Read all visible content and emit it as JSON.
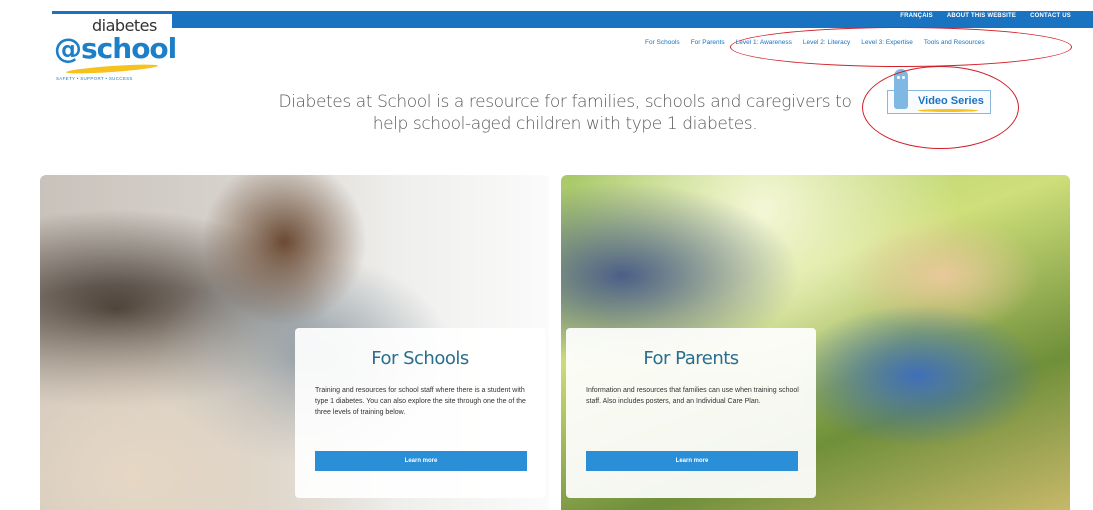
{
  "utility_nav": [
    "FRANÇAIS",
    "ABOUT THIS WEBSITE",
    "CONTACT US"
  ],
  "logo": {
    "word_top": "diabetes",
    "word_main": "@school",
    "tagline": "SAFETY • SUPPORT • SUCCESS"
  },
  "main_nav": [
    "For Schools",
    "For Parents",
    "Level 1: Awareness",
    "Level 2: Literacy",
    "Level 3: Expertise",
    "Tools and Resources"
  ],
  "hero": {
    "line1": "Diabetes at School is a resource for families, schools and caregivers to",
    "line2": "help school-aged children with type 1 diabetes."
  },
  "video_button": {
    "label": "Video Series"
  },
  "cards": {
    "schools": {
      "title": "For Schools",
      "description": "Training and resources for school staff where there is a student with type 1 diabetes. You can also explore the site through one the of the three levels of training below.",
      "button": "Learn more"
    },
    "parents": {
      "title": "For Parents",
      "description": "Information and resources that families can use when training school staff. Also includes posters, and an Individual Care Plan.",
      "button": "Learn more"
    }
  },
  "colors": {
    "brand_blue": "#1a73c0",
    "button_blue": "#2b8fd8",
    "highlight_red": "#d2202a",
    "accent_yellow": "#f6c21e"
  }
}
